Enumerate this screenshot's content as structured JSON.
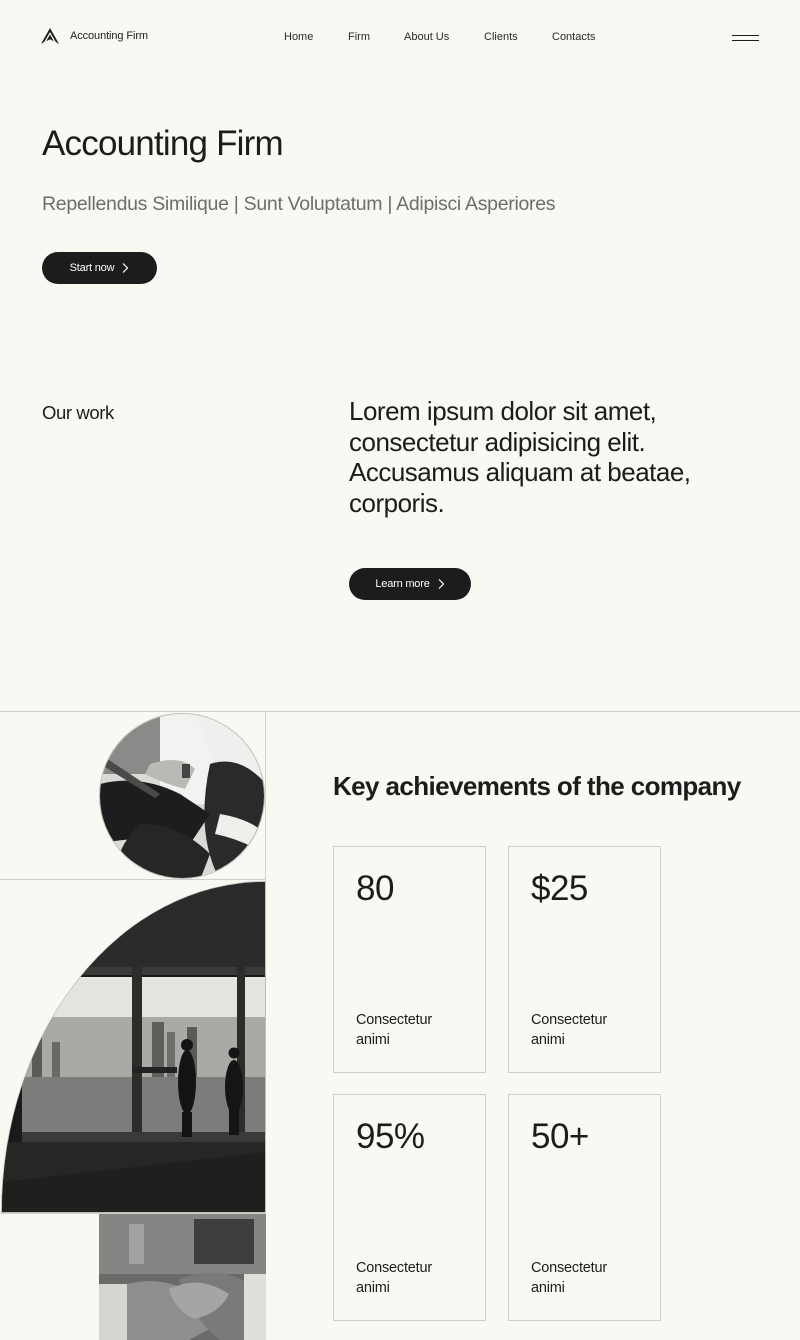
{
  "brand": {
    "name": "Accounting Firm"
  },
  "nav": [
    {
      "label": "Home"
    },
    {
      "label": "Firm"
    },
    {
      "label": "About Us"
    },
    {
      "label": "Clients"
    },
    {
      "label": "Contacts"
    }
  ],
  "hero": {
    "title": "Accounting Firm",
    "subtitle": "Repellendus Similique | Sunt Voluptatum | Adipisci Asperiores",
    "cta_label": "Start now"
  },
  "our_work": {
    "label": "Our work",
    "text": "Lorem ipsum dolor sit amet, consectetur adipisicing elit. Accusamus aliquam at beatae, corporis.",
    "cta_label": "Learn more"
  },
  "achievements": {
    "title": "Key achievements of the company",
    "cards": [
      {
        "value": "80",
        "caption": "Consectetur animi"
      },
      {
        "value": "$25",
        "caption": "Consectetur animi"
      },
      {
        "value": "95%",
        "caption": "Consectetur animi"
      },
      {
        "value": "50+",
        "caption": "Consectetur animi"
      }
    ]
  },
  "icons": {
    "logo": "logo-icon",
    "menu": "menu-icon",
    "chevron": "chevron-right-icon"
  },
  "colors": {
    "background": "#f9f8f3",
    "text": "#1c1c1c",
    "button": "#1c1c1c",
    "muted": "#6e6e6a"
  }
}
